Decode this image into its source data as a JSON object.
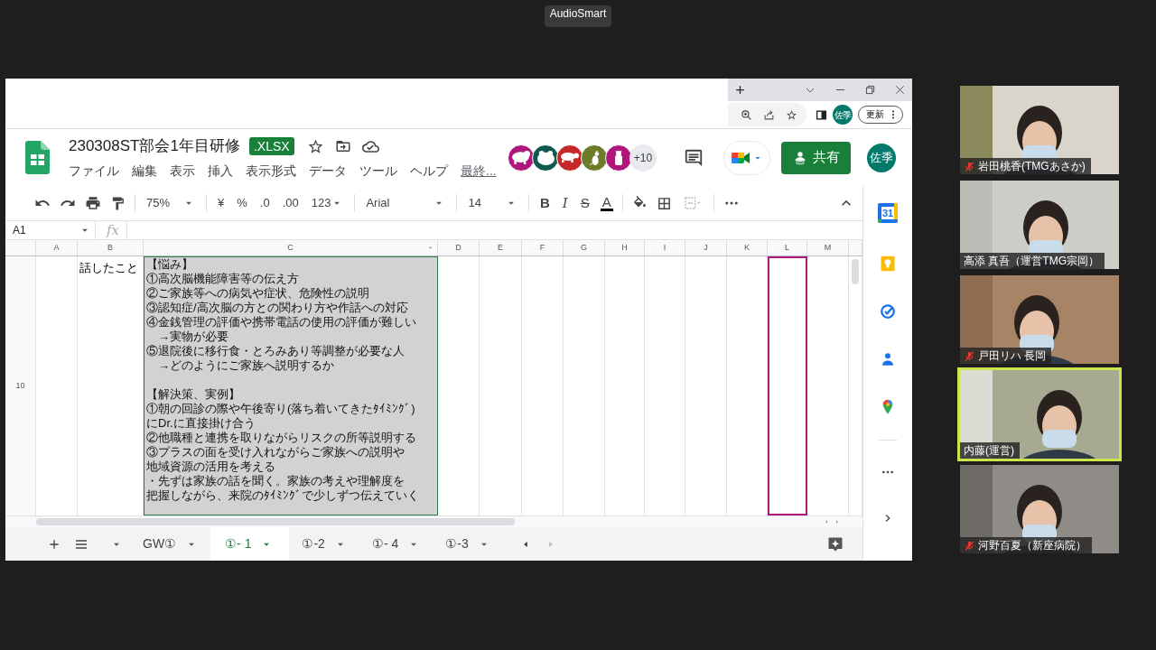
{
  "top_label": "AudioSmart",
  "browser": {
    "avatar": "佐季",
    "update_button": "更新"
  },
  "doc": {
    "title": "230308ST部会1年目研修",
    "badge": ".XLSX",
    "menus": [
      "ファイル",
      "編集",
      "表示",
      "挿入",
      "表示形式",
      "データ",
      "ツール",
      "ヘルプ"
    ],
    "last_edit": "最終...",
    "collaborators": [
      {
        "color": "#b0177d"
      },
      {
        "color": "#0f5a4d"
      },
      {
        "color": "#c62828"
      },
      {
        "color": "#6b7d2b"
      },
      {
        "color": "#b0177d"
      }
    ],
    "more_count": "+10",
    "share_button": "共有",
    "account_avatar": "佐季"
  },
  "toolbar": {
    "zoom": "75%",
    "currency": "¥",
    "percent": "%",
    "decrease_decimal": ".0",
    "increase_decimal": ".00",
    "number_format": "123",
    "font": "Arial",
    "font_size": "14",
    "bold": "B",
    "italic": "I",
    "strikethrough": "S",
    "text_color": "A"
  },
  "formula_bar": {
    "cell_ref": "A1",
    "fx": "fx"
  },
  "columns": [
    "A",
    "B",
    "C",
    "D",
    "E",
    "F",
    "G",
    "H",
    "I",
    "J",
    "K",
    "L",
    "M"
  ],
  "row": {
    "number": "10",
    "column_b": "話したこと",
    "column_c_sections": [
      {
        "lines": [
          {
            "text": "【悩み】",
            "indent": false
          },
          {
            "text": "①高次脳機能障害等の伝え方",
            "indent": false
          },
          {
            "text": "②ご家族等への病気や症状、危険性の説明",
            "indent": false
          },
          {
            "text": "③認知症/高次脳の方との関わり方や作話への対応",
            "indent": false
          },
          {
            "text": "④金銭管理の評価や携帯電話の使用の評価が難しい",
            "indent": false
          },
          {
            "text": "→実物が必要",
            "indent": true
          },
          {
            "text": "⑤退院後に移行食・とろみあり等調整が必要な人",
            "indent": false
          },
          {
            "text": "→どのようにご家族へ説明するか",
            "indent": true
          }
        ]
      },
      {
        "lines": [
          {
            "text": "【解決策、実例】",
            "indent": false
          },
          {
            "text": "①朝の回診の際や午後寄り(落ち着いてきたﾀｲﾐﾝｸﾞ)",
            "indent": false
          },
          {
            "text": "にDr.に直接掛け合う",
            "indent": false
          },
          {
            "text": "②他職種と連携を取りながらリスクの所等説明する",
            "indent": false
          },
          {
            "text": "③プラスの面を受け入れながらご家族への説明や",
            "indent": false
          },
          {
            "text": "地域資源の活用を考える",
            "indent": false
          },
          {
            "text": "・先ずは家族の話を聞く。家族の考えや理解度を",
            "indent": false
          },
          {
            "text": "把握しながら、来院のﾀｲﾐﾝｸﾞで少しずつ伝えていく",
            "indent": false
          }
        ]
      }
    ]
  },
  "side_panel": {
    "calendar_day": "31"
  },
  "sheet_tabs": [
    {
      "label": "GW①",
      "selected": false
    },
    {
      "label": "①- 1",
      "selected": true
    },
    {
      "label": "①-2",
      "selected": false
    },
    {
      "label": "①- 4",
      "selected": false
    },
    {
      "label": "①-3",
      "selected": false
    }
  ],
  "participants": [
    {
      "name": "岩田桃香(TMGあさか)",
      "muted": true,
      "speaking": false
    },
    {
      "name": "高添 真吾（運営TMG宗岡）",
      "muted": false,
      "speaking": false
    },
    {
      "name": "戸田リハ 長岡",
      "muted": true,
      "speaking": false
    },
    {
      "name": "内藤(運営)",
      "muted": false,
      "speaking": true
    },
    {
      "name": "河野百夏（新座病院）",
      "muted": true,
      "speaking": false
    }
  ]
}
